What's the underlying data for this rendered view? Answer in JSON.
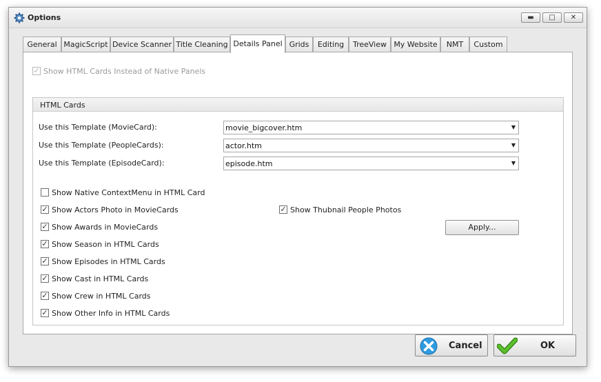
{
  "window": {
    "title": "Options",
    "title_icon": "gear-icon",
    "controls": {
      "minimize": "▬",
      "maximize": "□",
      "close": "✕"
    }
  },
  "tabs": [
    {
      "label": "General"
    },
    {
      "label": "MagicScript"
    },
    {
      "label": "Device Scanner"
    },
    {
      "label": "Title Cleaning"
    },
    {
      "label": "Details Panel",
      "active": true
    },
    {
      "label": "Grids"
    },
    {
      "label": "Editing"
    },
    {
      "label": "TreeView"
    },
    {
      "label": "My Website"
    },
    {
      "label": "NMT"
    },
    {
      "label": "Custom"
    }
  ],
  "panel": {
    "show_html_cards": {
      "label": "Show HTML Cards Instead of Native Panels",
      "checked": true,
      "enabled": false
    },
    "group": {
      "title": "HTML Cards",
      "templates": [
        {
          "label": "Use this Template (MovieCard):",
          "value": "movie_bigcover.htm"
        },
        {
          "label": "Use this Template (PeopleCards):",
          "value": "actor.htm"
        },
        {
          "label": "Use this Template (EpisodeCard):",
          "value": "episode.htm"
        }
      ],
      "apply_label": "Apply...",
      "options": [
        {
          "label": "Show Native ContextMenu in HTML Card",
          "checked": false
        },
        {
          "label": "Show Actors Photo in MovieCards",
          "checked": true
        },
        {
          "label": "Show Thubnail People Photos",
          "checked": true
        },
        {
          "label": "Show Awards in MovieCards",
          "checked": true
        },
        {
          "label": "Show Season in HTML Cards",
          "checked": true
        },
        {
          "label": "Show Episodes in HTML Cards",
          "checked": true
        },
        {
          "label": "Show Cast in HTML Cards",
          "checked": true
        },
        {
          "label": "Show Crew in HTML Cards",
          "checked": true
        },
        {
          "label": "Show Other Info in HTML Cards",
          "checked": true
        }
      ]
    }
  },
  "footer": {
    "cancel_label": "Cancel",
    "ok_label": "OK"
  },
  "colors": {
    "cancel_icon": "#2f9be0",
    "ok_icon": "#5cc02c"
  }
}
